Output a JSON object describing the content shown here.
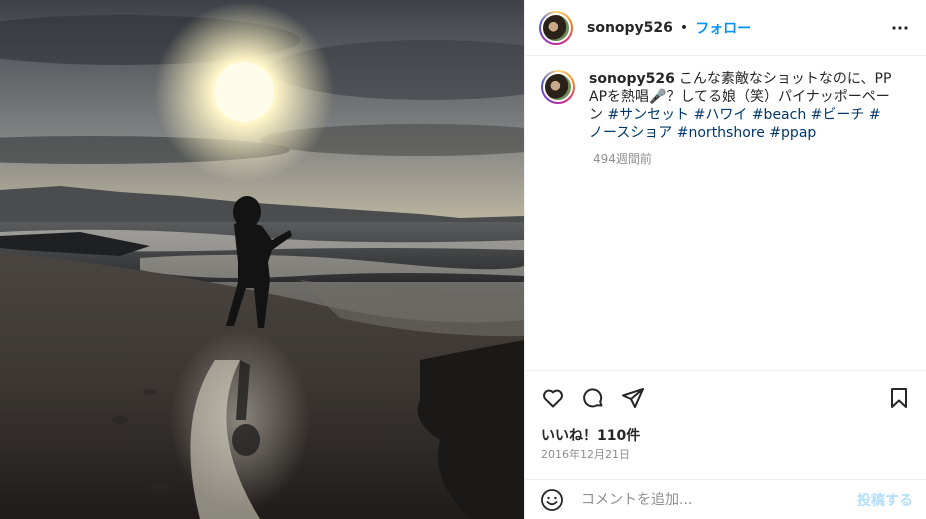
{
  "post": {
    "username": "sonopy526",
    "separator": "•",
    "follow_label": "フォロー",
    "caption": {
      "username": "sonopy526",
      "text": "こんな素敵なショットなのに、PPAPを熱唱🎤？してる娘（笑）パイナッポーペーン ",
      "hashtags": [
        "#サンセット",
        "#ハワイ",
        "#beach",
        "#ビーチ",
        "#ノースショア",
        "#northshore",
        "#ppap"
      ],
      "time_ago": "494週間前"
    },
    "likes": "いいね！110件",
    "date": "2016年12月21日",
    "comment_placeholder": "コメントを追加...",
    "post_label": "投稿する"
  },
  "icons": {
    "more": "more-horizontal-icon",
    "like": "heart-icon",
    "comment": "comment-icon",
    "share": "paper-plane-icon",
    "save": "bookmark-icon",
    "emoji": "emoji-icon"
  },
  "colors": {
    "accent": "#0095f6",
    "hashtag": "#00376b",
    "muted": "#8e8e8e",
    "post_disabled": "#b2dffc"
  }
}
